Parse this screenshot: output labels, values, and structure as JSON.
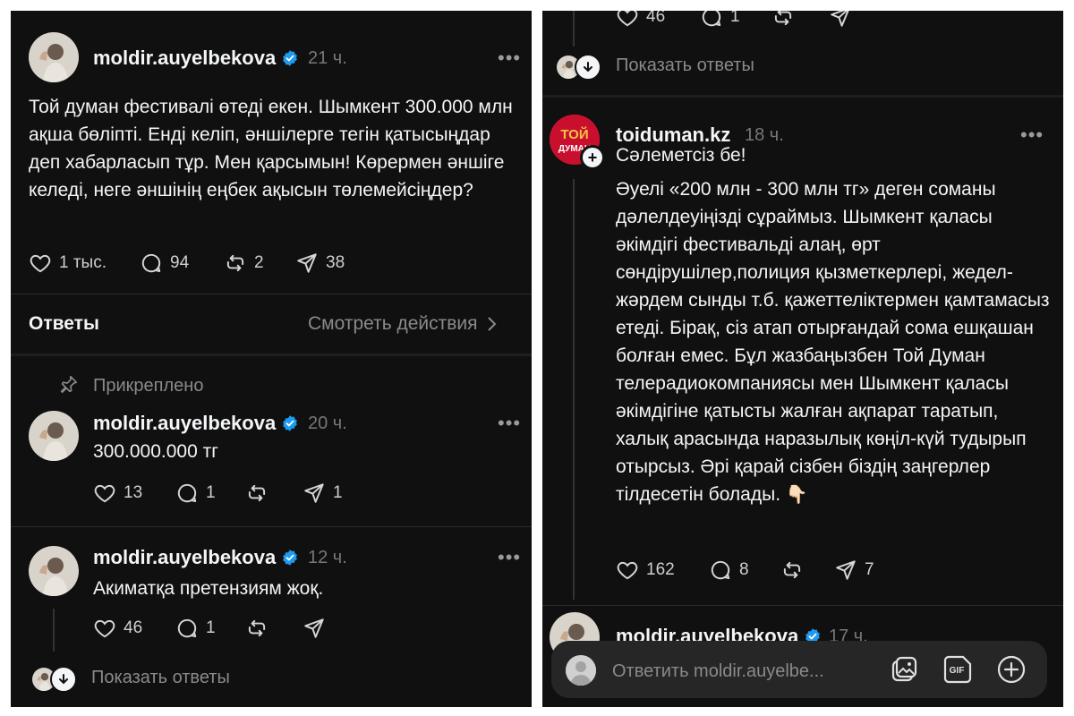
{
  "left": {
    "post": {
      "username": "moldir.auyelbekova",
      "time": "21 ч.",
      "more": "•••",
      "text": "Той думан фестивалі өтеді екен. Шымкент 300.000 млн ақша бөліпті. Енді келіп, әншілерге тегін қатысыңдар деп хабарласып тұр. Мен қарсымын! Көрермен әншіге келеді, неге әншінің еңбек ақысын төлемейсіңдер?",
      "likes": "1 тыс.",
      "comments": "94",
      "reposts": "2",
      "shares": "38"
    },
    "replies_header": {
      "title": "Ответы",
      "view_activity": "Смотреть действия"
    },
    "pinned_label": "Прикреплено",
    "reply1": {
      "username": "moldir.auyelbekova",
      "time": "20 ч.",
      "more": "•••",
      "text": "300.000.000 тг",
      "likes": "13",
      "comments": "1",
      "shares": "1"
    },
    "reply2": {
      "username": "moldir.auyelbekova",
      "time": "12 ч.",
      "more": "•••",
      "text": "Акиматқа претензиям жоқ.",
      "likes": "46",
      "comments": "1"
    },
    "show_replies": "Показать ответы"
  },
  "right": {
    "top_actions": {
      "likes": "46",
      "comments": "1"
    },
    "show_replies": "Показать ответы",
    "post": {
      "username": "toiduman.kz",
      "time": "18 ч.",
      "more": "•••",
      "greeting": "Сәлеметсіз бе!",
      "text": "Әуелі «200 млн - 300 млн тг» деген соманы дәлелдеуіңізді сұраймыз. Шымкент қаласы әкімдігі фестивальді алаң, өрт сөндірушілер,полиция қызметкерлері, жедел-жәрдем сынды  т.б. қажеттеліктермен қамтамасыз етеді. Бірақ, сіз атап отырғандай сома ешқашан болған емес. Бұл жазбаңызбен Той Думан телерадиокомпаниясы мен Шымкент қаласы әкімдігіне қатысты жалған ақпарат таратып, халық арасында наразылық көңіл-күй тудырып отырсыз. Әрі қарай сізбен біздің заңгерлер тілдесетін болады.",
      "emoji": "👇🏻",
      "logo_text_top": "ТОЙ",
      "logo_text_bottom": "ДУМАН",
      "likes": "162",
      "comments": "8",
      "shares": "7"
    },
    "next_reply": {
      "username": "moldir.auyelbekova",
      "time": "17 ч."
    },
    "reply_bar": {
      "placeholder": "Ответить moldir.auyelbe...",
      "gif_label": "GIF"
    }
  },
  "colors": {
    "background": "#101010",
    "text": "#f3f5f7",
    "muted": "#8a8a8a",
    "verified": "#1d9bf0",
    "logo_red": "#c8102e",
    "logo_gold": "#f6c343"
  },
  "icons": [
    "heart-icon",
    "comment-icon",
    "repost-icon",
    "share-icon",
    "verified-icon",
    "more-icon",
    "pin-icon",
    "chevron-right-icon",
    "arrow-down-icon",
    "plus-icon",
    "image-icon",
    "gif-icon",
    "add-icon"
  ]
}
